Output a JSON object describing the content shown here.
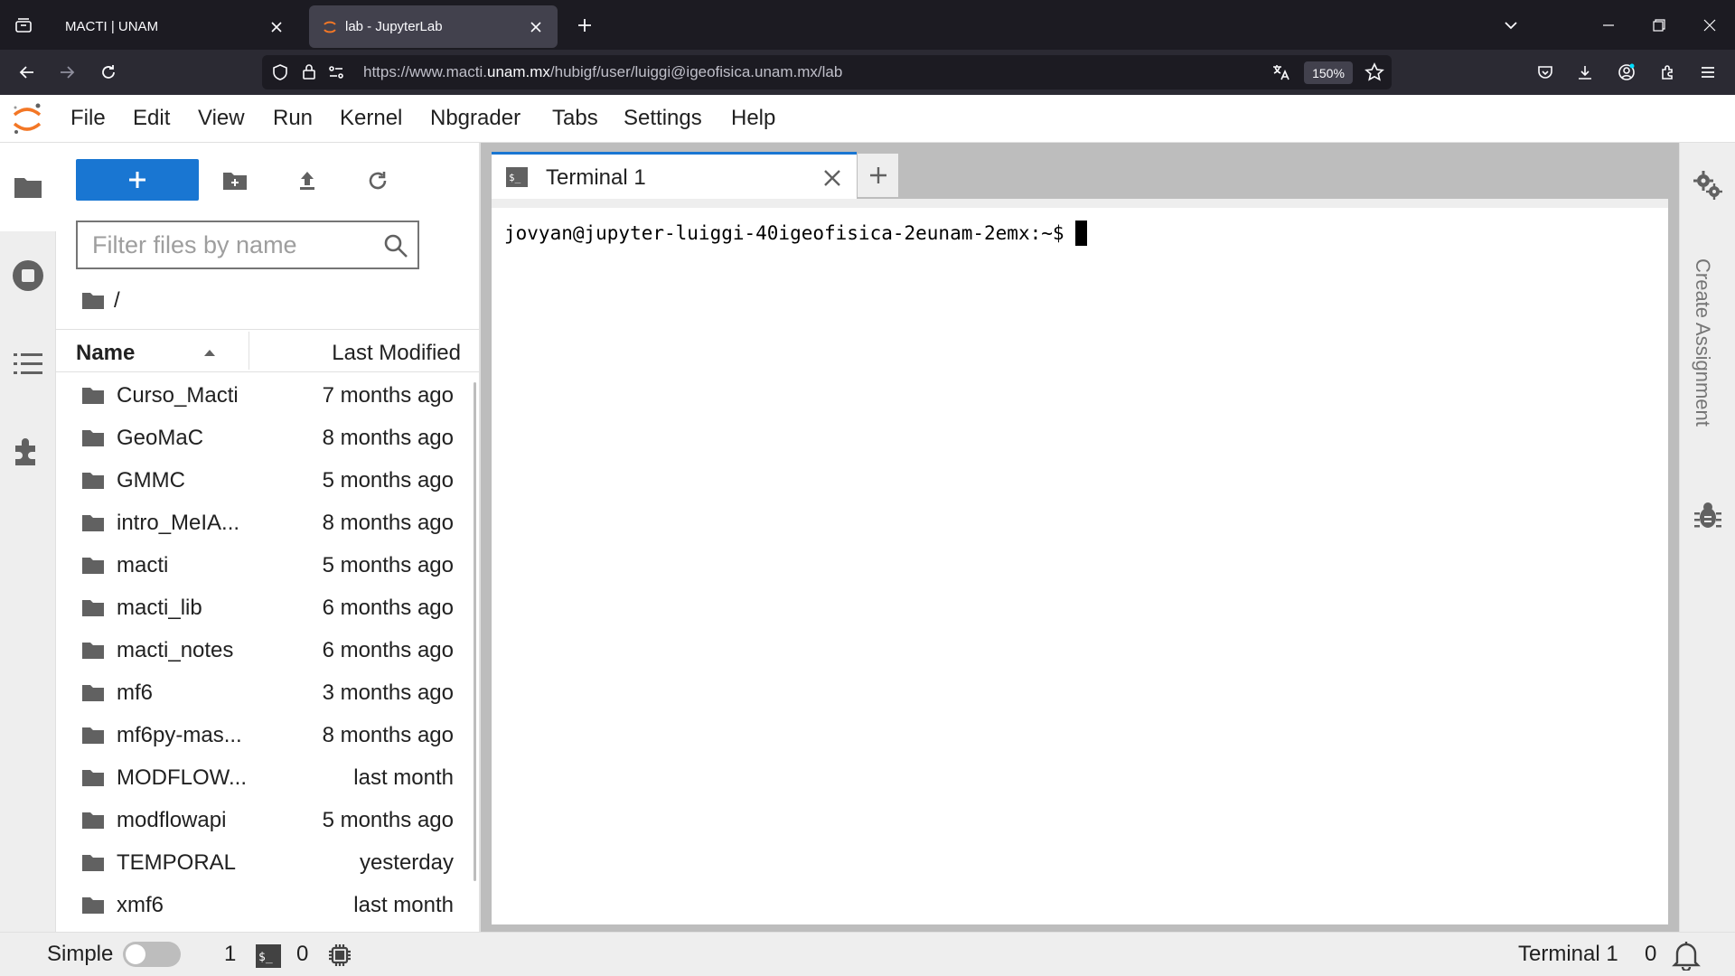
{
  "browser": {
    "tabs": [
      {
        "title": "MACTI | UNAM",
        "active": false
      },
      {
        "title": "lab - JupyterLab",
        "active": true
      }
    ],
    "url_prefix": "https://www.macti.",
    "url_host": "unam.mx",
    "url_path": "/hubigf/user/luiggi@igeofisica.unam.mx/lab",
    "zoom": "150%"
  },
  "menubar": {
    "items": [
      "File",
      "Edit",
      "View",
      "Run",
      "Kernel",
      "Nbgrader",
      "Tabs",
      "Settings",
      "Help"
    ]
  },
  "filebrowser": {
    "filter_placeholder": "Filter files by name",
    "breadcrumb": "/",
    "col_name": "Name",
    "col_modified": "Last Modified",
    "files": [
      {
        "name": "Curso_Macti",
        "modified": "7 months ago"
      },
      {
        "name": "GeoMaC",
        "modified": "8 months ago"
      },
      {
        "name": "GMMC",
        "modified": "5 months ago"
      },
      {
        "name": "intro_MeIA...",
        "modified": "8 months ago"
      },
      {
        "name": "macti",
        "modified": "5 months ago"
      },
      {
        "name": "macti_lib",
        "modified": "6 months ago"
      },
      {
        "name": "macti_notes",
        "modified": "6 months ago"
      },
      {
        "name": "mf6",
        "modified": "3 months ago"
      },
      {
        "name": "mf6py-mas...",
        "modified": "8 months ago"
      },
      {
        "name": "MODFLOW...",
        "modified": "last month"
      },
      {
        "name": "modflowapi",
        "modified": "5 months ago"
      },
      {
        "name": "TEMPORAL",
        "modified": "yesterday"
      },
      {
        "name": "xmf6",
        "modified": "last month"
      }
    ]
  },
  "main": {
    "tab_label": "Terminal 1",
    "terminal_prompt": "jovyan@jupyter-luiggi-40igeofisica-2eunam-2emx:~$"
  },
  "right_rail": {
    "label": "Create Assignment"
  },
  "statusbar": {
    "simple_label": "Simple",
    "terminals_count": "1",
    "kernels_count": "0",
    "active_label": "Terminal 1",
    "notifications_count": "0"
  },
  "colors": {
    "accent": "#1976d2",
    "jupyter_orange": "#f37726"
  }
}
